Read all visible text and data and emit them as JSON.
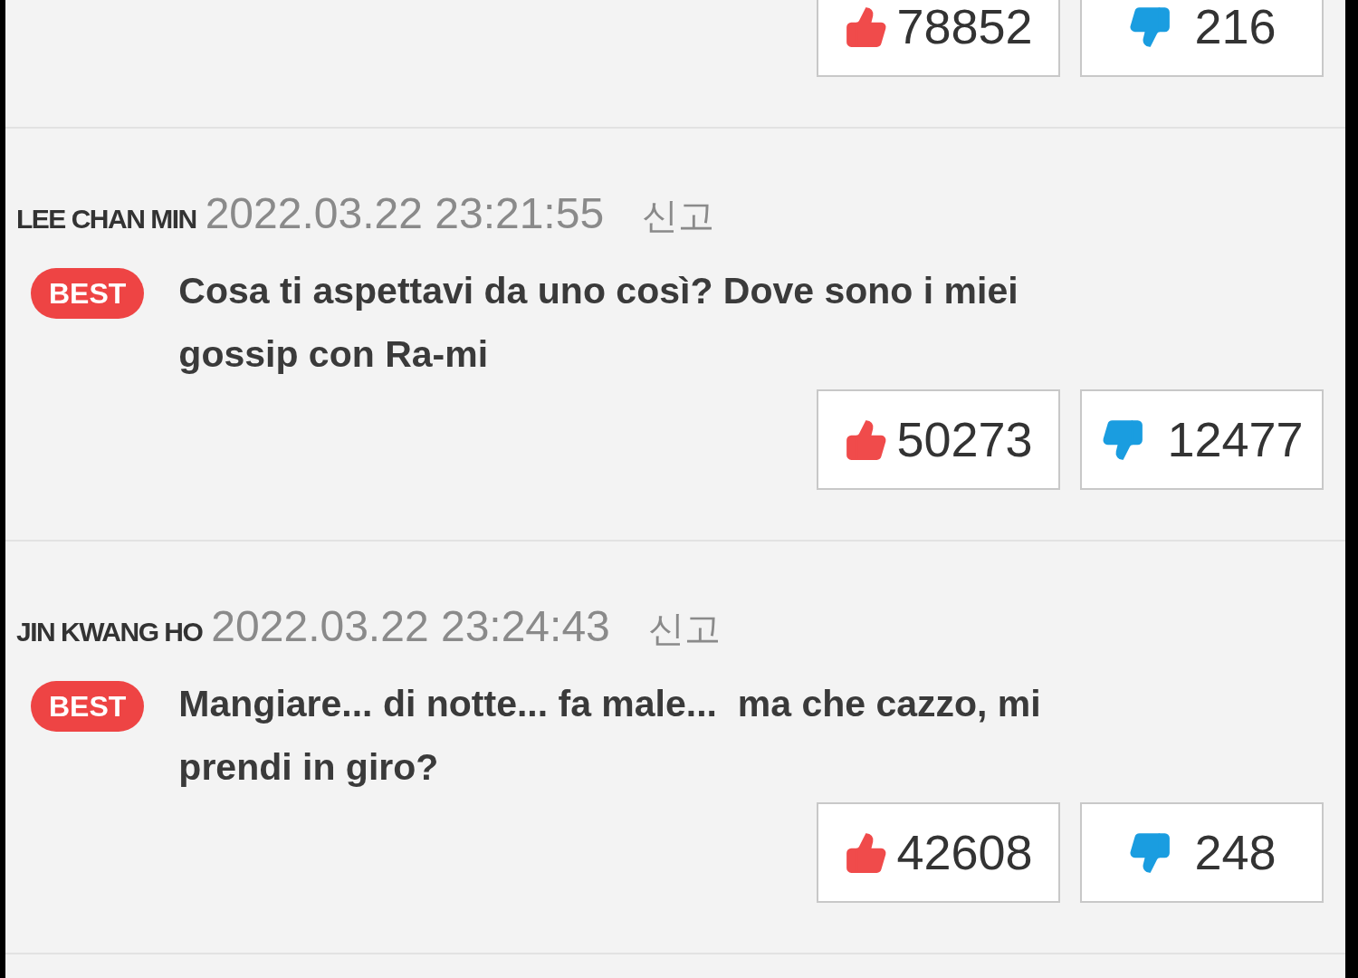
{
  "comments": [
    {
      "likes": "78852",
      "dislikes": "216"
    },
    {
      "author": "LEE CHAN MIN",
      "timestamp": "2022.03.22 23:21:55",
      "report": "신고",
      "badge": "BEST",
      "text": "Cosa ti aspettavi da uno così? Dove sono i miei gossip con Ra-mi",
      "likes": "50273",
      "dislikes": "12477"
    },
    {
      "author": "JIN KWANG HO",
      "timestamp": "2022.03.22 23:24:43",
      "report": "신고",
      "badge": "BEST",
      "text": "Mangiare... di notte... fa male...  ma che cazzo, mi prendi in giro?",
      "likes": "42608",
      "dislikes": "248"
    }
  ]
}
